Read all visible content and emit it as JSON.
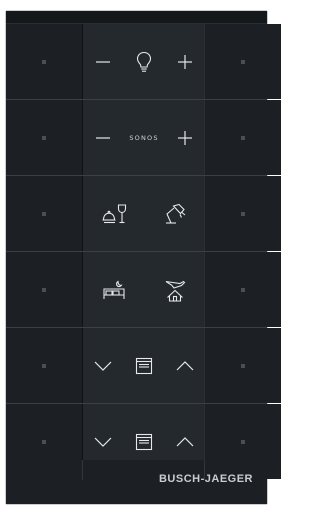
{
  "brand": "BUSCH-JAEGER",
  "rows": [
    {
      "type": "dimmer",
      "minus": "minus-icon",
      "center_icon": "light-bulb-icon",
      "plus": "plus-icon"
    },
    {
      "type": "sonos",
      "minus": "minus-icon",
      "center_label": "SONOS",
      "plus": "plus-icon"
    },
    {
      "type": "scenes",
      "left_icon": "dinner-scene-icon",
      "right_icon": "desk-lamp-icon"
    },
    {
      "type": "scenes",
      "left_icon": "sleep-scene-icon",
      "right_icon": "away-home-icon"
    },
    {
      "type": "blind",
      "down": "chevron-down-icon",
      "center_icon": "blind-icon",
      "up": "chevron-up-icon"
    },
    {
      "type": "blind",
      "down": "chevron-down-icon",
      "center_icon": "blind-icon",
      "up": "chevron-up-icon"
    }
  ],
  "colors": {
    "panel": "#1b1e22",
    "center_strip": "#23292d",
    "icon": "#e6e8ea",
    "indicator": "#4a4f55"
  }
}
